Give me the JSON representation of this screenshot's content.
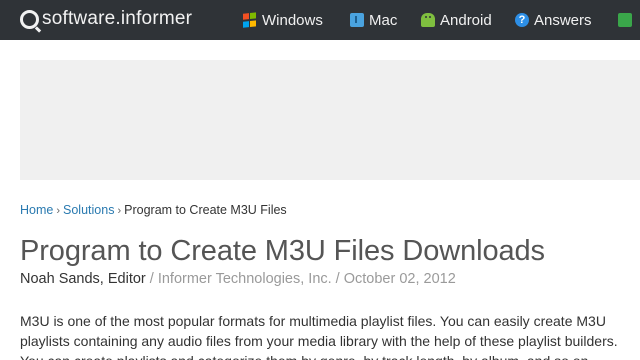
{
  "site": {
    "logo_text": "software.informer"
  },
  "nav": [
    {
      "label": "Windows",
      "icon": "windows-icon"
    },
    {
      "label": "Mac",
      "icon": "mac-icon"
    },
    {
      "label": "Android",
      "icon": "android-icon"
    },
    {
      "label": "Answers",
      "icon": "question-icon"
    },
    {
      "label": "",
      "icon": "chat-icon"
    }
  ],
  "breadcrumb": {
    "home": "Home",
    "solutions": "Solutions",
    "current": "Program to Create M3U Files"
  },
  "page": {
    "title": "Program to Create M3U Files Downloads",
    "author": "Noah Sands, Editor",
    "publisher": " / Informer Technologies, Inc. / ",
    "date": "October 02, 2012"
  },
  "article": {
    "lines": [
      "M3U is one of the most popular formats for multimedia playlist files. You can easily create M3U",
      "playlists containing any audio files from your media library with the help of these playlist builders.",
      "You can create playlists and categorize them by genre, by track length, by album, and so on."
    ]
  },
  "colors": {
    "topbar": "#2f3337",
    "link": "#2a7ab0",
    "ad_area": "#f0f0f0"
  }
}
